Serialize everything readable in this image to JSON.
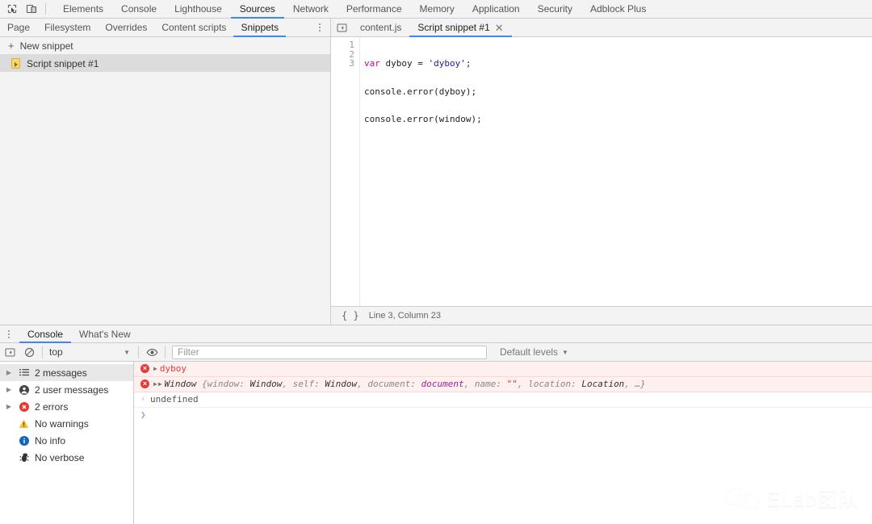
{
  "toolbar": {
    "inspect_icon": "inspect-cursor-icon",
    "device_icon": "device-toolbar-icon"
  },
  "main_tabs": [
    {
      "label": "Elements",
      "active": false
    },
    {
      "label": "Console",
      "active": false
    },
    {
      "label": "Lighthouse",
      "active": false
    },
    {
      "label": "Sources",
      "active": true
    },
    {
      "label": "Network",
      "active": false
    },
    {
      "label": "Performance",
      "active": false
    },
    {
      "label": "Memory",
      "active": false
    },
    {
      "label": "Application",
      "active": false
    },
    {
      "label": "Security",
      "active": false
    },
    {
      "label": "Adblock Plus",
      "active": false
    }
  ],
  "sub_tabs": [
    {
      "label": "Page",
      "active": false
    },
    {
      "label": "Filesystem",
      "active": false
    },
    {
      "label": "Overrides",
      "active": false
    },
    {
      "label": "Content scripts",
      "active": false
    },
    {
      "label": "Snippets",
      "active": true
    }
  ],
  "navigator": {
    "new_snippet_label": "New snippet",
    "new_snippet_icon": "plus-icon",
    "items": [
      {
        "label": "Script snippet #1",
        "icon": "script-snippet-icon",
        "selected": true
      }
    ]
  },
  "editor": {
    "panel_toggle_icon": "show-navigator-icon",
    "tabs": [
      {
        "label": "content.js",
        "active": false,
        "closable": false
      },
      {
        "label": "Script snippet #1",
        "active": true,
        "closable": true,
        "close_icon": "close-icon"
      }
    ],
    "lines": [
      {
        "num": "1",
        "tokens": [
          {
            "t": "var",
            "c": "kw"
          },
          {
            "t": " dyboy = ",
            "c": "pln"
          },
          {
            "t": "'dyboy'",
            "c": "str"
          },
          {
            "t": ";",
            "c": "pln"
          }
        ]
      },
      {
        "num": "2",
        "tokens": [
          {
            "t": "console.error(dyboy);",
            "c": "pln"
          }
        ]
      },
      {
        "num": "3",
        "tokens": [
          {
            "t": "console.error(window);",
            "c": "pln"
          }
        ]
      }
    ],
    "status": {
      "format_icon": "pretty-print-braces-icon",
      "format_label": "{ }",
      "cursor_label": "Line 3, Column 23"
    }
  },
  "drawer": {
    "kebab_icon": "more-options-icon",
    "tabs": [
      {
        "label": "Console",
        "active": true
      },
      {
        "label": "What's New",
        "active": false
      }
    ],
    "console_toolbar": {
      "sidebar_toggle_icon": "console-sidebar-toggle-icon",
      "clear_icon": "clear-console-icon",
      "context_value": "top",
      "context_caret_icon": "chevron-down-icon",
      "eye_icon": "live-expression-eye-icon",
      "filter_placeholder": "Filter",
      "filter_value": "",
      "levels_label": "Default levels",
      "levels_caret_icon": "chevron-down-icon"
    },
    "sidebar": [
      {
        "label": "2 messages",
        "icon": "list-icon",
        "expandable": true,
        "selected": true
      },
      {
        "label": "2 user messages",
        "icon": "user-icon",
        "expandable": true,
        "selected": false
      },
      {
        "label": "2 errors",
        "icon": "error-icon",
        "expandable": true,
        "selected": false
      },
      {
        "label": "No warnings",
        "icon": "warning-icon",
        "expandable": false,
        "selected": false
      },
      {
        "label": "No info",
        "icon": "info-icon",
        "expandable": false,
        "selected": false
      },
      {
        "label": "No verbose",
        "icon": "verbose-bug-icon",
        "expandable": false,
        "selected": false
      }
    ],
    "messages": [
      {
        "kind": "error",
        "badge_icon": "error-badge-icon",
        "badge_glyph": "×",
        "arrows": 1,
        "arrow_icon": "expand-triangle-icon",
        "segments": [
          {
            "t": "dyboy",
            "c": "err-txt"
          }
        ]
      },
      {
        "kind": "error",
        "badge_icon": "error-badge-icon",
        "badge_glyph": "×",
        "arrows": 2,
        "arrow_icon": "expand-triangle-icon",
        "segments": [
          {
            "t": "Window ",
            "c": "obj-name"
          },
          {
            "t": "{",
            "c": "obj-prop"
          },
          {
            "t": "window: ",
            "c": "obj-prop"
          },
          {
            "t": "Window",
            "c": "obj-val"
          },
          {
            "t": ", ",
            "c": "obj-prop"
          },
          {
            "t": "self: ",
            "c": "obj-prop"
          },
          {
            "t": "Window",
            "c": "obj-val"
          },
          {
            "t": ", ",
            "c": "obj-prop"
          },
          {
            "t": "document: ",
            "c": "obj-prop"
          },
          {
            "t": "document",
            "c": "obj-doc"
          },
          {
            "t": ", ",
            "c": "obj-prop"
          },
          {
            "t": "name: ",
            "c": "obj-prop"
          },
          {
            "t": "\"\"",
            "c": "obj-str"
          },
          {
            "t": ", ",
            "c": "obj-prop"
          },
          {
            "t": "location: ",
            "c": "obj-prop"
          },
          {
            "t": "Location",
            "c": "obj-val"
          },
          {
            "t": ", …}",
            "c": "obj-prop"
          }
        ]
      },
      {
        "kind": "result",
        "return_icon": "return-value-arrow-icon",
        "return_glyph": "‹",
        "segments": [
          {
            "t": "undefined",
            "c": "ret-val"
          }
        ]
      }
    ],
    "prompt": {
      "glyph": "❯",
      "icon": "console-prompt-icon",
      "value": ""
    }
  },
  "watermark": {
    "text": "ELab团队",
    "icon": "wechat-logo-icon"
  }
}
